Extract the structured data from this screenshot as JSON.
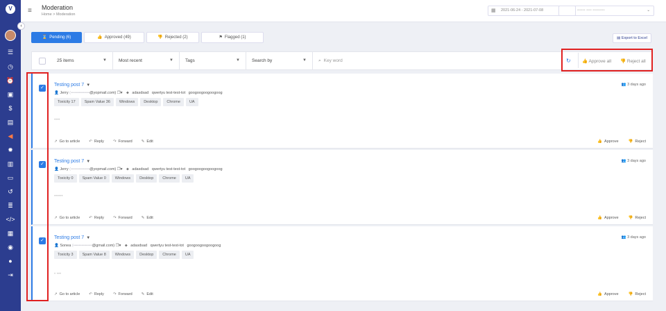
{
  "header": {
    "title": "Moderation",
    "breadcrumb": "Home > Moderation",
    "date_range": "2021-06-24 - 2021-07-08",
    "account_placeholder": "•••••• •••• •••••••••"
  },
  "sidebar": {
    "logo": "V",
    "icons": [
      "list-icon",
      "clock-icon",
      "alarm-icon",
      "book-icon",
      "dollar-icon",
      "ad-icon",
      "megaphone-icon",
      "gear-icon",
      "chart-icon",
      "card-icon",
      "history-icon",
      "rows-icon",
      "code-icon",
      "building-icon",
      "support-icon",
      "chat-icon",
      "logout-icon"
    ]
  },
  "tabs": [
    {
      "label": "Pending (6)",
      "icon": "hourglass-icon",
      "active": true
    },
    {
      "label": "Approved (49)",
      "icon": "thumbs-up-icon",
      "active": false
    },
    {
      "label": "Rejected (2)",
      "icon": "thumbs-down-icon",
      "active": false
    },
    {
      "label": "Flagged (1)",
      "icon": "flag-icon",
      "active": false
    }
  ],
  "export_label": "Export to Excel",
  "filters": {
    "items": "25 items",
    "sort": "Most recent",
    "tags": "Tags",
    "search_by": "Search by",
    "keyword_placeholder": "Key word"
  },
  "bulk": {
    "approve_all": "Approve all",
    "reject_all": "Reject all"
  },
  "posts": [
    {
      "title": "Testing post 7",
      "author": "Jerry",
      "email_masked": "(••••••••••••••",
      "email_domain": "@yopmail.com)",
      "tags": [
        "adasdsad",
        "qwertyu test-test-tot",
        "googoogoogoogoog"
      ],
      "time": "3 days ago",
      "chips": [
        "Toxicity 17",
        "Spam Value 36",
        "Windows",
        "Desktop",
        "Chrome",
        "UA"
      ],
      "body": "••••"
    },
    {
      "title": "Testing post 7",
      "author": "Jerry",
      "email_masked": "(••••••••••••••",
      "email_domain": "@yopmail.com)",
      "tags": [
        "adasdsad",
        "qwertyu test-test-tot",
        "googoogoogoogoog"
      ],
      "time": "3 days ago",
      "chips": [
        "Toxicity 0",
        "Spam Value 0",
        "Windows",
        "Desktop",
        "Chrome",
        "UA"
      ],
      "body": "••••••"
    },
    {
      "title": "Testing post 7",
      "author": "Sonea",
      "email_masked": "(••••••••••••••",
      "email_domain": "@gmail.com)",
      "tags": [
        "adasdsad",
        "qwertyu test-test-tot",
        "googoogoogoogoog"
      ],
      "time": "3 days ago",
      "chips": [
        "Toxicity 3",
        "Spam Value 8",
        "Windows",
        "Desktop",
        "Chrome",
        "UA"
      ],
      "body": "• •••"
    }
  ],
  "post_actions": {
    "go_to_article": "Go to article",
    "reply": "Reply",
    "forward": "Forward",
    "edit": "Edit",
    "approve": "Approve",
    "reject": "Reject"
  },
  "colors": {
    "sidebar": "#2c3d8f",
    "accent": "#2c7be5",
    "highlight": "#e02020"
  }
}
